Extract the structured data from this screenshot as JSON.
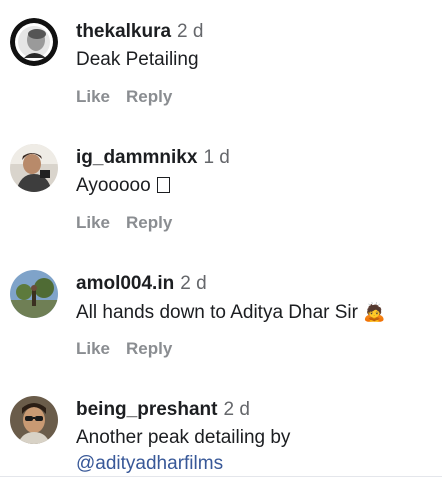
{
  "comments": [
    {
      "username": "thekalkura",
      "time": "2 d",
      "text": "Deak Petailing",
      "like_label": "Like",
      "reply_label": "Reply"
    },
    {
      "username": "ig_dammnikx",
      "time": "1 d",
      "text": "Ayooooo",
      "like_label": "Like",
      "reply_label": "Reply"
    },
    {
      "username": "amol004.in",
      "time": "2 d",
      "text": "All hands down to Aditya Dhar Sir",
      "emoji": "🙇",
      "like_label": "Like",
      "reply_label": "Reply"
    },
    {
      "username": "being_preshant",
      "time": "2 d",
      "text": "Another peak detailing by",
      "mention": "@adityadharfilms"
    }
  ]
}
